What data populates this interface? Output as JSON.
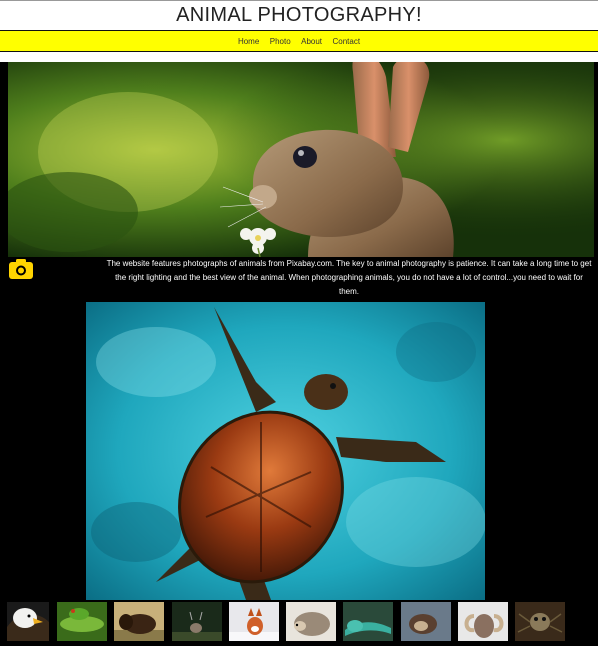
{
  "header": {
    "title": "ANIMAL PHOTOGRAPHY!"
  },
  "nav": {
    "items": [
      {
        "label": "Home"
      },
      {
        "label": "Photo"
      },
      {
        "label": "About"
      },
      {
        "label": "Contact"
      }
    ]
  },
  "intro": {
    "text": "The website features photographs of animals from Pixabay.com. The key to animal photography is patience. It can take a long time to get the right lighting and the best view of the animal. When photographing animals, you do not have a lot of control...you need to wait for them."
  },
  "gallery": {
    "thumbnails": [
      "bald eagle",
      "frog",
      "bison",
      "deer",
      "fox",
      "hedgehog",
      "lizard",
      "otter",
      "ram",
      "spider"
    ]
  },
  "colors": {
    "nav_background": "#ffff00",
    "page_background": "#000000",
    "camera_icon": "#ffd400"
  }
}
